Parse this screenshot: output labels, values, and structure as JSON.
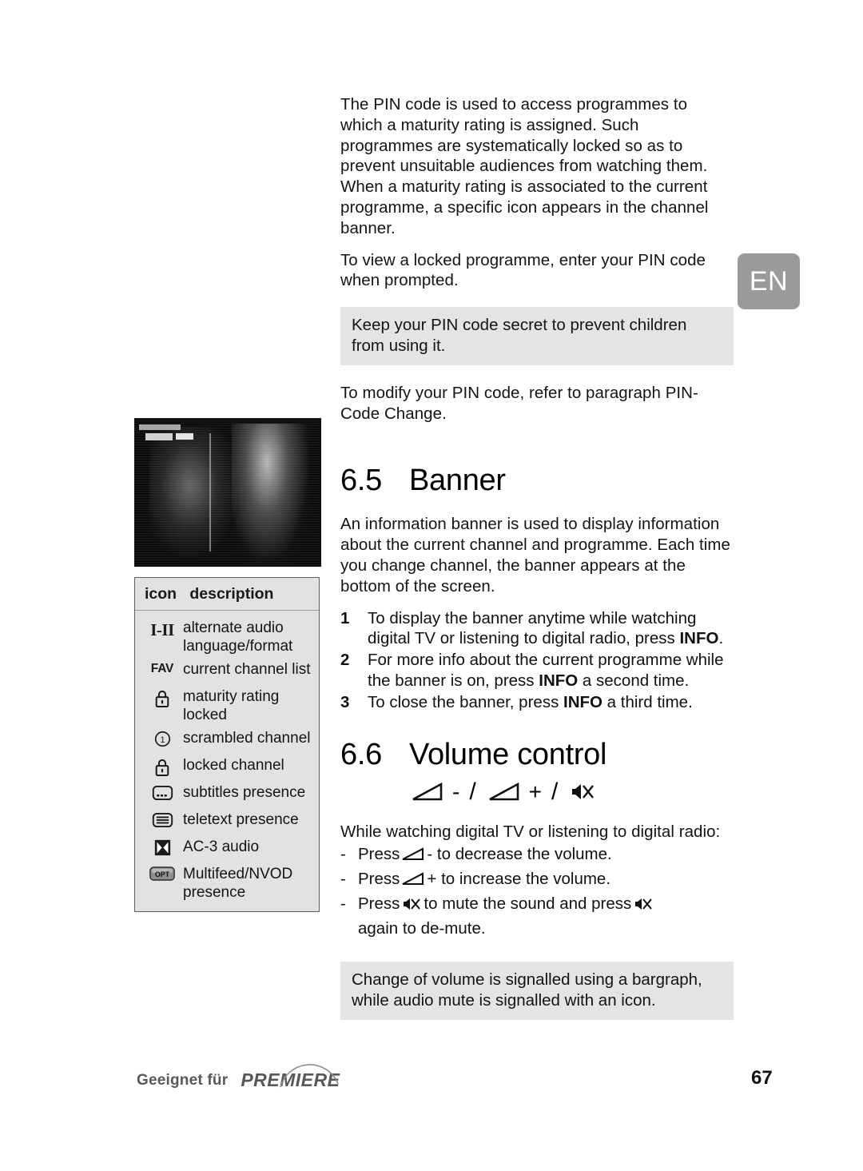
{
  "page": {
    "number": "67",
    "language_tab": "EN"
  },
  "intro": {
    "paragraph_1": "The PIN code is used to access programmes to which a maturity rating is assigned. Such programmes are systematically locked so as to prevent unsuitable audiences from watching them. When a maturity rating is associated to the current programme, a specific icon appears in the channel banner.",
    "paragraph_2": "To view a locked programme, enter your PIN code when prompted.",
    "note_1": "Keep your PIN code secret to prevent children from using it.",
    "paragraph_3": "To modify your PIN code, refer to paragraph PIN-Code Change."
  },
  "banner_section": {
    "number": "6.5",
    "title": "Banner",
    "intro": "An information banner is used to display information about the current channel and programme. Each time you change channel, the banner appears at the bottom of the screen.",
    "steps": [
      {
        "index": "1",
        "text_before": "To display the banner anytime while watching digital TV or listening to digital radio, press ",
        "key": "INFO",
        "text_after": "."
      },
      {
        "index": "2",
        "text_before": "For more info about the current programme while the banner is on, press ",
        "key": "INFO",
        "text_after": " a second time."
      },
      {
        "index": "3",
        "text_before": "To close the banner, press ",
        "key": "INFO",
        "text_after": " a third time."
      }
    ]
  },
  "volume_section": {
    "number": "6.6",
    "title": "Volume control",
    "symbol_line": {
      "volume_down_icon": "volume-wedge-icon",
      "minus": "-",
      "separator_1": "/",
      "volume_up_icon": "volume-wedge-icon",
      "plus": "+",
      "separator_2": "/",
      "mute_icon": "mute-speaker-icon"
    },
    "intro": "While watching digital TV or listening to digital radio:",
    "bullets": [
      {
        "dash": "-",
        "text_before": "Press ",
        "icon": "volume-wedge-icon",
        "text_mid": "- to decrease the volume.",
        "icon_2": null,
        "text_after": ""
      },
      {
        "dash": "-",
        "text_before": "Press ",
        "icon": "volume-wedge-icon",
        "text_mid": "+ to increase the volume.",
        "icon_2": null,
        "text_after": ""
      },
      {
        "dash": "-",
        "text_before": "Press ",
        "icon": "mute-speaker-icon",
        "text_mid": " to mute the sound and press ",
        "icon_2": "mute-speaker-icon",
        "text_after": " again to de-mute."
      }
    ],
    "note": "Change of volume is signalled using a bargraph, while audio mute is signalled with an icon."
  },
  "icon_table": {
    "header": {
      "col_icon": "icon",
      "col_description": "description"
    },
    "rows": [
      {
        "icon": "alternate-audio-icon",
        "glyph": "I-II",
        "description": "alternate audio language/format"
      },
      {
        "icon": "fav-icon",
        "glyph": "FAV",
        "description": "current channel list"
      },
      {
        "icon": "padlock-icon",
        "glyph": "",
        "description": "maturity rating locked"
      },
      {
        "icon": "scrambled-channel-icon",
        "glyph": "1",
        "description": "scrambled channel"
      },
      {
        "icon": "padlock-icon",
        "glyph": "",
        "description": "locked channel"
      },
      {
        "icon": "subtitles-icon",
        "glyph": "",
        "description": "subtitles presence"
      },
      {
        "icon": "teletext-icon",
        "glyph": "",
        "description": "teletext presence"
      },
      {
        "icon": "ac3-audio-icon",
        "glyph": "",
        "description": "AC-3 audio"
      },
      {
        "icon": "opt-icon",
        "glyph": "OPT",
        "description": "Multifeed/NVOD presence"
      }
    ]
  },
  "footer": {
    "logo_prefix": "Geeignet für",
    "logo_brand": "PREMIERE"
  },
  "colors": {
    "note_background": "#e4e4e4",
    "tab_background": "#9a9a9a",
    "table_background": "#e2e2e2",
    "table_border": "#5d5d5d",
    "logo_gray": "#585858"
  }
}
